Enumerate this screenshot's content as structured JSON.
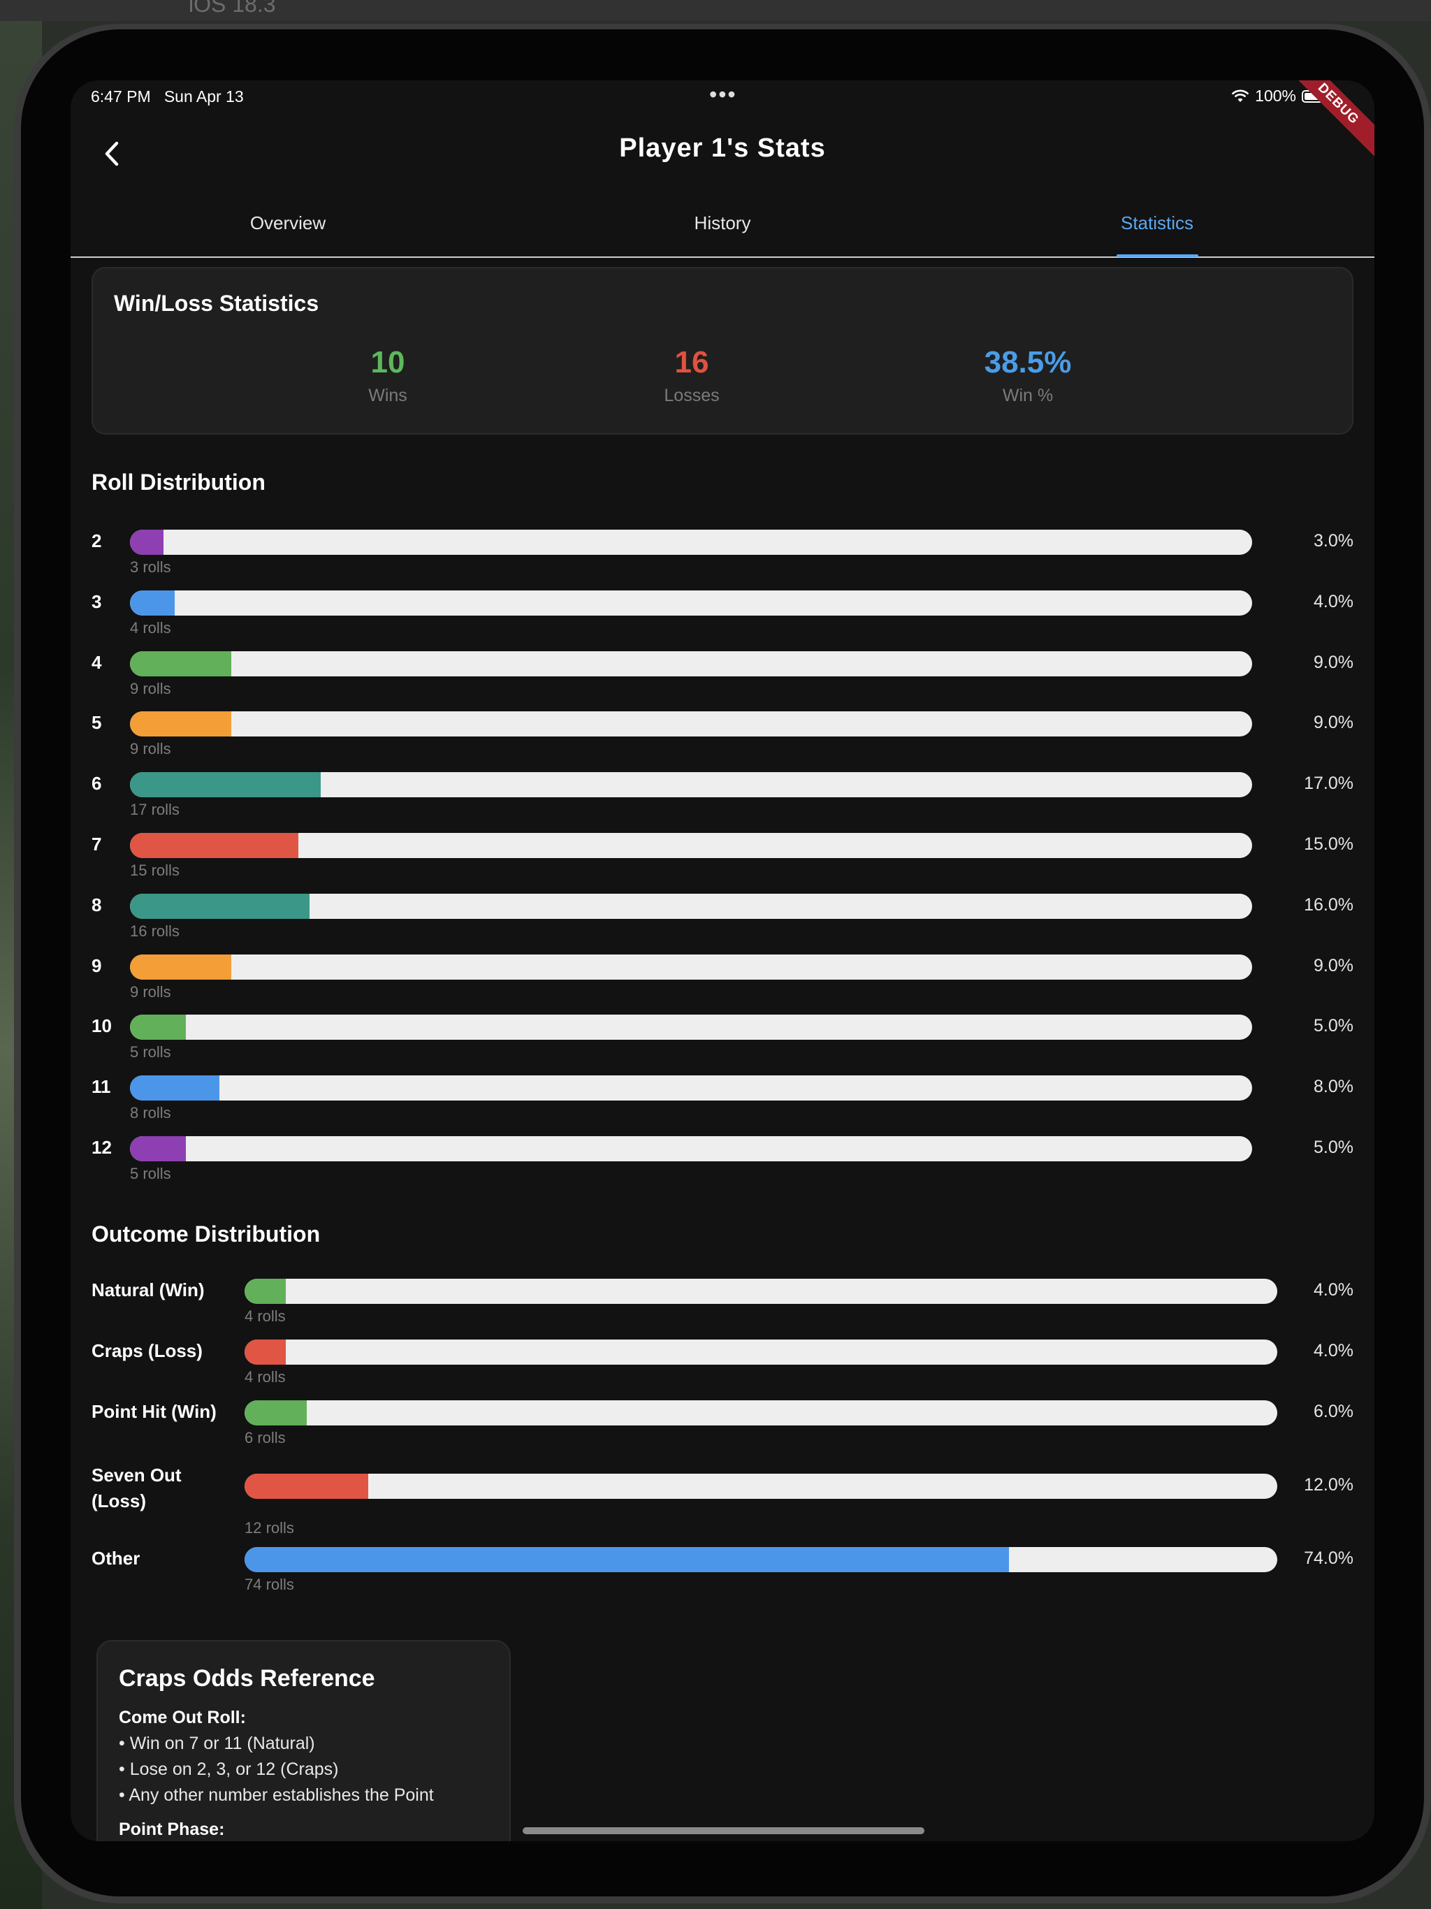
{
  "device": {
    "label": "iOS 18.3"
  },
  "status_bar": {
    "time": "6:47 PM",
    "date": "Sun Apr 13",
    "battery": "100%",
    "debug": "DEBUG"
  },
  "header": {
    "title": "Player 1's Stats"
  },
  "tabs": [
    {
      "label": "Overview",
      "active": false
    },
    {
      "label": "History",
      "active": false
    },
    {
      "label": "Statistics",
      "active": true
    }
  ],
  "win_loss": {
    "heading": "Win/Loss Statistics",
    "wins": {
      "value": "10",
      "label": "Wins",
      "color": "#5cb85c"
    },
    "losses": {
      "value": "16",
      "label": "Losses",
      "color": "#e0523f"
    },
    "win_pct": {
      "value": "38.5%",
      "label": "Win %",
      "color": "#4a9de8"
    }
  },
  "roll_distribution": {
    "heading": "Roll Distribution",
    "rows": [
      {
        "label": "2",
        "pct": "3.0%",
        "fraction": 0.03,
        "count": "3 rolls",
        "color": "#8e3fb2"
      },
      {
        "label": "3",
        "pct": "4.0%",
        "fraction": 0.04,
        "count": "4 rolls",
        "color": "#4c96ea"
      },
      {
        "label": "4",
        "pct": "9.0%",
        "fraction": 0.09,
        "count": "9 rolls",
        "color": "#62b05a"
      },
      {
        "label": "5",
        "pct": "9.0%",
        "fraction": 0.09,
        "count": "9 rolls",
        "color": "#f39e36"
      },
      {
        "label": "6",
        "pct": "17.0%",
        "fraction": 0.17,
        "count": "17 rolls",
        "color": "#3b9787"
      },
      {
        "label": "7",
        "pct": "15.0%",
        "fraction": 0.15,
        "count": "15 rolls",
        "color": "#e15544"
      },
      {
        "label": "8",
        "pct": "16.0%",
        "fraction": 0.16,
        "count": "16 rolls",
        "color": "#3b9787"
      },
      {
        "label": "9",
        "pct": "9.0%",
        "fraction": 0.09,
        "count": "9 rolls",
        "color": "#f39e36"
      },
      {
        "label": "10",
        "pct": "5.0%",
        "fraction": 0.05,
        "count": "5 rolls",
        "color": "#62b05a"
      },
      {
        "label": "11",
        "pct": "8.0%",
        "fraction": 0.08,
        "count": "8 rolls",
        "color": "#4c96ea"
      },
      {
        "label": "12",
        "pct": "5.0%",
        "fraction": 0.05,
        "count": "5 rolls",
        "color": "#8e3fb2"
      }
    ]
  },
  "outcome_distribution": {
    "heading": "Outcome Distribution",
    "rows": [
      {
        "label": "Natural (Win)",
        "pct": "4.0%",
        "fraction": 0.04,
        "count": "4 rolls",
        "color": "#62b05a"
      },
      {
        "label": "Craps (Loss)",
        "pct": "4.0%",
        "fraction": 0.04,
        "count": "4 rolls",
        "color": "#e15544"
      },
      {
        "label": "Point Hit (Win)",
        "pct": "6.0%",
        "fraction": 0.06,
        "count": "6 rolls",
        "color": "#62b05a"
      },
      {
        "label": "Seven Out\n(Loss)",
        "pct": "12.0%",
        "fraction": 0.12,
        "count": "12 rolls",
        "color": "#e15544"
      },
      {
        "label": "Other",
        "pct": "74.0%",
        "fraction": 0.74,
        "count": "74 rolls",
        "color": "#4c96ea"
      }
    ]
  },
  "odds_reference": {
    "heading": "Craps Odds Reference",
    "come_out_title": "Come Out Roll:",
    "come_out_items": [
      "• Win on 7 or 11 (Natural)",
      "• Lose on 2, 3, or 12 (Craps)",
      "• Any other number establishes the Point"
    ],
    "point_phase_title": "Point Phase:"
  }
}
